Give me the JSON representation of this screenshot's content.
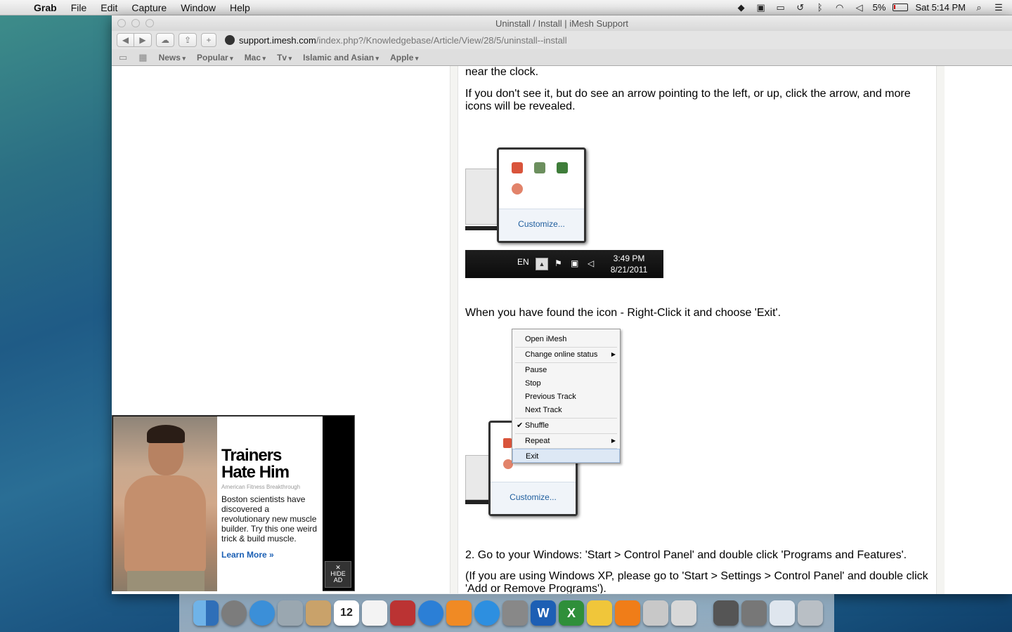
{
  "menubar": {
    "app_name": "Grab",
    "items": [
      "File",
      "Edit",
      "Capture",
      "Window",
      "Help"
    ],
    "battery": "5%",
    "clock": "Sat 5:14 PM"
  },
  "window": {
    "title": "Uninstall / Install | iMesh Support",
    "url_host": "support.imesh.com",
    "url_path": "/index.php?/Knowledgebase/Article/View/28/5/uninstall--install",
    "bookmarks": [
      "News",
      "Popular",
      "Mac",
      "Tv",
      "Islamic and Asian",
      "Apple"
    ]
  },
  "article": {
    "line1": "near the clock.",
    "para2": "If you don't see it, but do see an arrow pointing to the left, or up, click the arrow, and more icons will be revealed.",
    "tray_customize": "Customize...",
    "taskbar_lang": "EN",
    "taskbar_time": "3:49 PM",
    "taskbar_date": "8/21/2011",
    "para3": "When you have found the icon - Right-Click it and choose 'Exit'.",
    "context_menu": {
      "open": "Open iMesh",
      "status": "Change online status",
      "pause": "Pause",
      "stop": "Stop",
      "prev": "Previous Track",
      "next": "Next Track",
      "shuffle": "Shuffle",
      "repeat": "Repeat",
      "exit": "Exit"
    },
    "tray_customize_2": "Customize...",
    "para4": "2. Go to your Windows: 'Start > Control Panel' and double click 'Programs and Features'.",
    "para5": "(If you are using Windows XP, please go to 'Start > Settings > Control Panel' and double click 'Add or Remove Programs')."
  },
  "ad": {
    "title": "Trainers Hate Him",
    "subtitle": "American Fitness Breakthrough",
    "body": "Boston scientists have discovered a revolutionary new muscle builder. Try this one weird trick & build muscle.",
    "link": "Learn More »",
    "hide_top": "HIDE",
    "hide_bottom": "AD"
  },
  "dock": {
    "calendar_day": "12"
  }
}
